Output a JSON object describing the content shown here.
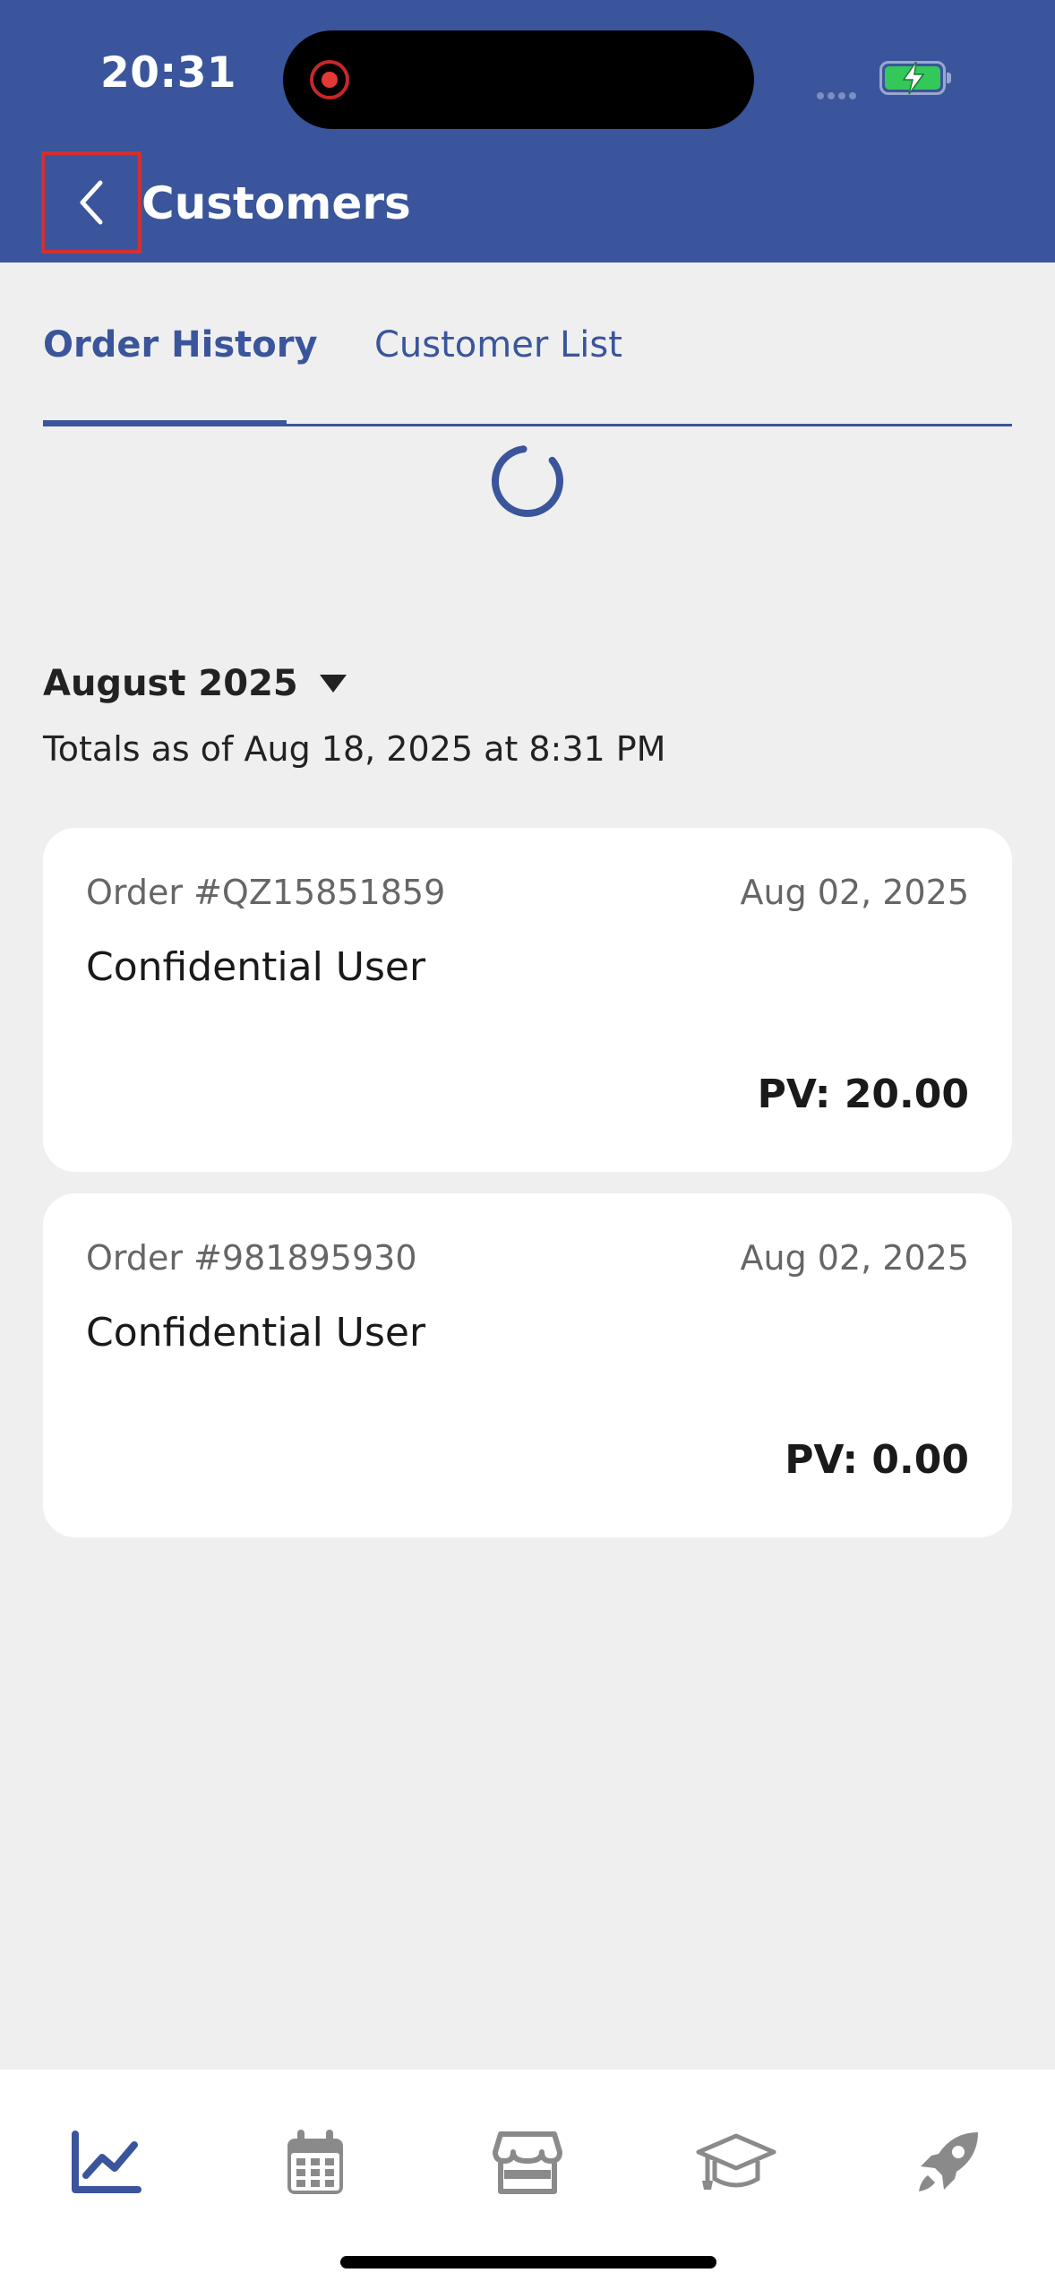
{
  "status_bar": {
    "time": "20:31"
  },
  "header": {
    "title": "Customers",
    "back_icon": "chevron-left-icon"
  },
  "tabs": [
    {
      "label": "Order History",
      "active": true
    },
    {
      "label": "Customer List",
      "active": false
    }
  ],
  "period": {
    "month": "August 2025",
    "totals_text": "Totals as of Aug 18, 2025 at 8:31 PM"
  },
  "orders": [
    {
      "order_no": "Order #QZ15851859",
      "date": "Aug 02, 2025",
      "customer": "Confidential User",
      "pv": "PV: 20.00"
    },
    {
      "order_no": "Order #981895930",
      "date": "Aug 02, 2025",
      "customer": "Confidential User",
      "pv": "PV: 0.00"
    }
  ],
  "bottom_nav": [
    {
      "icon": "chart-line-icon",
      "active": true
    },
    {
      "icon": "calendar-icon",
      "active": false
    },
    {
      "icon": "store-icon",
      "active": false
    },
    {
      "icon": "graduation-cap-icon",
      "active": false
    },
    {
      "icon": "rocket-icon",
      "active": false
    }
  ],
  "colors": {
    "primary": "#3a559b",
    "background": "#efefef",
    "inactive_icon": "#8a8a8a"
  }
}
